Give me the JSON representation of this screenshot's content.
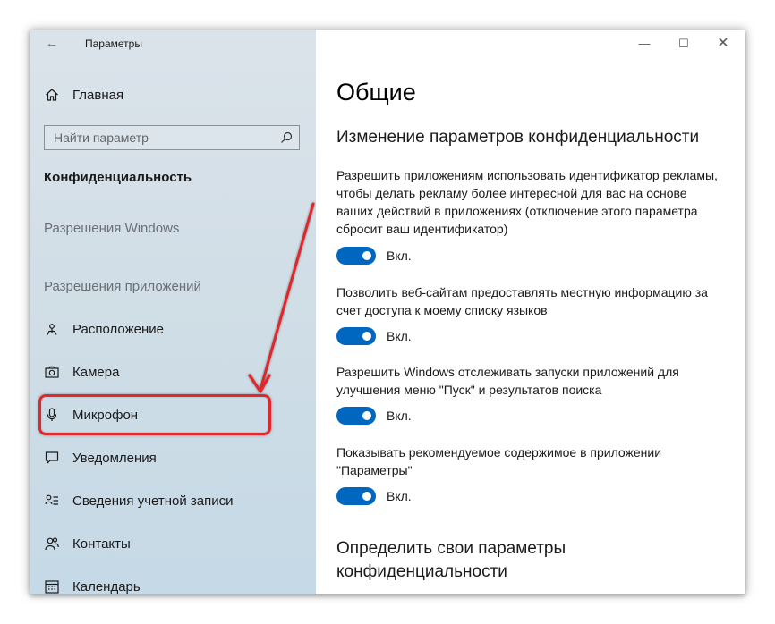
{
  "window": {
    "title": "Параметры",
    "minimize": "—",
    "maximize": "☐",
    "close": "✕"
  },
  "sidebar": {
    "home_label": "Главная",
    "search_placeholder": "Найти параметр",
    "section_title": "Конфиденциальность",
    "group_windows": "Разрешения Windows",
    "group_apps": "Разрешения приложений",
    "items": [
      {
        "label": "Расположение",
        "icon": "location-icon"
      },
      {
        "label": "Камера",
        "icon": "camera-icon"
      },
      {
        "label": "Микрофон",
        "icon": "microphone-icon"
      },
      {
        "label": "Уведомления",
        "icon": "notification-icon"
      },
      {
        "label": "Сведения учетной записи",
        "icon": "account-info-icon"
      },
      {
        "label": "Контакты",
        "icon": "contacts-icon"
      },
      {
        "label": "Календарь",
        "icon": "calendar-icon"
      }
    ]
  },
  "main": {
    "title": "Общие",
    "heading": "Изменение параметров конфиденциальности",
    "settings": [
      {
        "description": "Разрешить приложениям использовать идентификатор рекламы, чтобы делать рекламу более интересной для вас на основе ваших действий в приложениях (отключение этого параметра сбросит ваш идентификатор)",
        "state": "Вкл."
      },
      {
        "description": "Позволить веб-сайтам предоставлять местную информацию за счет доступа к моему списку языков",
        "state": "Вкл."
      },
      {
        "description": "Разрешить Windows отслеживать запуски приложений для улучшения меню \"Пуск\" и результатов поиска",
        "state": "Вкл."
      },
      {
        "description": "Показывать рекомендуемое содержимое в приложении \"Параметры\"",
        "state": "Вкл."
      }
    ],
    "heading2": "Определить свои параметры конфиденциальности"
  },
  "colors": {
    "accent": "#0067c0",
    "annotation": "#e0282c"
  }
}
